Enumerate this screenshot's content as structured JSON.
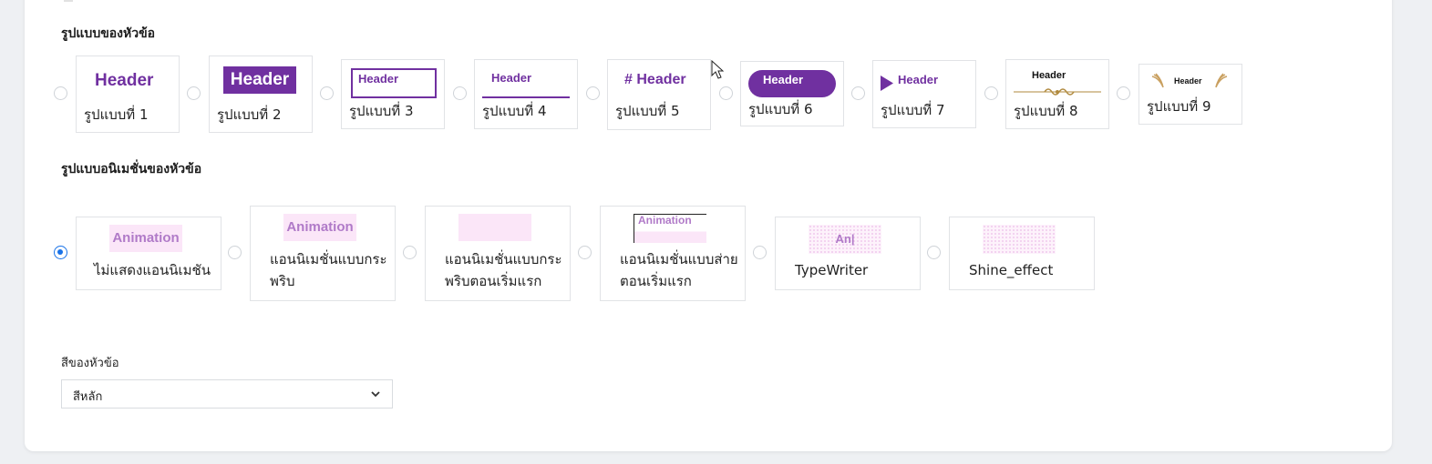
{
  "header_style": {
    "title": "รูปแบบของหัวข้อ",
    "preview_text": "Header",
    "hash_prefix": "#",
    "options": [
      {
        "label": "รูปแบบที่ 1",
        "selected": false
      },
      {
        "label": "รูปแบบที่ 2",
        "selected": false
      },
      {
        "label": "รูปแบบที่ 3",
        "selected": false
      },
      {
        "label": "รูปแบบที่ 4",
        "selected": false
      },
      {
        "label": "รูปแบบที่ 5",
        "selected": false
      },
      {
        "label": "รูปแบบที่ 6",
        "selected": false
      },
      {
        "label": "รูปแบบที่ 7",
        "selected": false
      },
      {
        "label": "รูปแบบที่ 8",
        "selected": false
      },
      {
        "label": "รูปแบบที่ 9",
        "selected": false
      }
    ]
  },
  "header_animation": {
    "title": "รูปแบบอนิเมชั่นของหัวข้อ",
    "preview_text": "Animation",
    "typewriter_preview": "An|",
    "options": [
      {
        "label": "ไม่แสดงแอนนิเมชัน",
        "selected": true
      },
      {
        "label": "แอนนิเมชั่นแบบกระพริบ",
        "selected": false
      },
      {
        "label": "แอนนิเมชั่นแบบกระพริบตอนเริ่มแรก",
        "selected": false
      },
      {
        "label": "แอนนิเมชั่นแบบส่ายตอนเริ่มแรก",
        "selected": false
      },
      {
        "label": "TypeWriter",
        "selected": false
      },
      {
        "label": "Shine_effect",
        "selected": false
      }
    ]
  },
  "header_color": {
    "label": "สีของหัวข้อ",
    "selected_value": "สีหลัก"
  },
  "colors": {
    "accent_purple": "#7030a0",
    "radio_checked": "#1a73e8",
    "ornament_gold": "#b08a3e"
  },
  "icons": [
    "chevron-down-icon",
    "play-triangle-icon",
    "wings-icon",
    "ornament-divider-icon",
    "mouse-cursor-icon"
  ]
}
